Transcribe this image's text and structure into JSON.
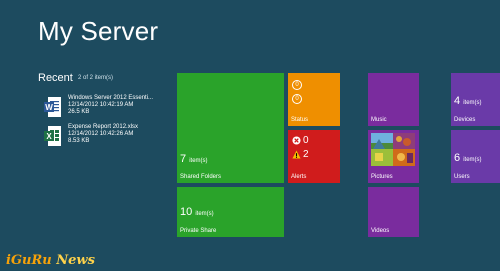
{
  "page_title": "My Server",
  "recent": {
    "header": "Recent",
    "count": "2 of 2 item(s)",
    "files": [
      {
        "name": "Windows Server 2012 Essenti...",
        "date": "12/14/2012 10:42:19 AM",
        "size": "26.5 KB",
        "icon": "word-doc-icon"
      },
      {
        "name": "Expense Report 2012.xlsx",
        "date": "12/14/2012 10:42:26 AM",
        "size": "8.53 KB",
        "icon": "excel-doc-icon"
      }
    ]
  },
  "tiles": {
    "shared_folders": {
      "count": "7",
      "unit": "item(s)",
      "label": "Shared Folders",
      "color": "#2aa32a"
    },
    "private_share": {
      "count": "10",
      "unit": "item(s)",
      "label": "Private Share",
      "color": "#2aa32a"
    },
    "status": {
      "label": "Status",
      "icon1": "0",
      "icon2": "0",
      "color": "#ef8f00"
    },
    "alerts": {
      "label": "Alerts",
      "critical": "0",
      "warnings": "2",
      "color": "#d01c1c"
    },
    "music": {
      "label": "Music",
      "color": "#7a2c9e"
    },
    "pictures": {
      "label": "Pictures",
      "color": "#7a2c9e"
    },
    "videos": {
      "label": "Videos",
      "color": "#7a2c9e"
    },
    "devices": {
      "count": "4",
      "unit": "item(s)",
      "label": "Devices",
      "color": "#6a3aa8"
    },
    "users": {
      "count": "6",
      "unit": "item(s)",
      "label": "Users",
      "color": "#6a3aa8"
    }
  },
  "watermark": {
    "part1": "iGuRu",
    "part2": "News"
  }
}
